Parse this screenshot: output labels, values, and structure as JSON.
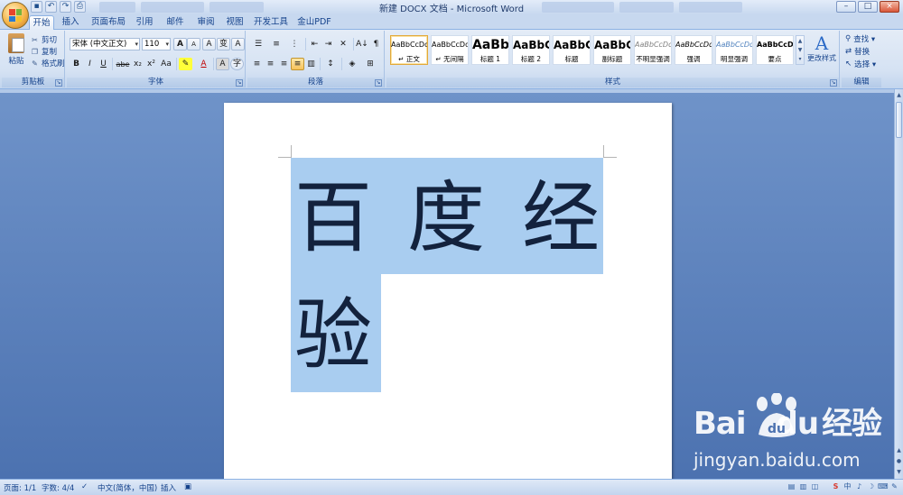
{
  "window": {
    "title": "新建 DOCX 文档 - Microsoft Word",
    "controls": [
      "–",
      "□",
      "×"
    ]
  },
  "quick_access": [
    "save-icon",
    "undo-icon",
    "redo-icon",
    "print-preview-icon"
  ],
  "tabs": [
    {
      "label": "开始",
      "active": true
    },
    {
      "label": "插入"
    },
    {
      "label": "页面布局"
    },
    {
      "label": "引用"
    },
    {
      "label": "邮件"
    },
    {
      "label": "审阅"
    },
    {
      "label": "视图"
    },
    {
      "label": "开发工具"
    },
    {
      "label": "金山PDF"
    }
  ],
  "clipboard": {
    "paste": "粘贴",
    "cut": "剪切",
    "copy": "复制",
    "format_painter": "格式刷",
    "label": "剪贴板"
  },
  "font": {
    "font_name": "宋体 (中文正文)",
    "font_size": "110",
    "label": "字体",
    "buttons": [
      "B",
      "I",
      "U",
      "abe",
      "x₂",
      "x²",
      "Aa",
      "A",
      "A"
    ],
    "grow": "A",
    "shrink": "A",
    "clear": "A",
    "phonetic": "变",
    "border_char": "A",
    "enclose": "字"
  },
  "paragraph": {
    "label": "段落",
    "sort": "A↓",
    "show_marks": "¶"
  },
  "styles": {
    "label": "样式",
    "items": [
      {
        "sample": "AaBbCcDd",
        "name": "↵ 正文",
        "selected": true
      },
      {
        "sample": "AaBbCcDd",
        "name": "↵ 无间隔"
      },
      {
        "sample": "AaBb",
        "name": "标题 1"
      },
      {
        "sample": "AaBbC",
        "name": "标题 2"
      },
      {
        "sample": "AaBbC",
        "name": "标题"
      },
      {
        "sample": "AaBbC",
        "name": "副标题"
      },
      {
        "sample": "AaBbCcDd",
        "name": "不明显强调"
      },
      {
        "sample": "AaBbCcDd",
        "name": "强调"
      },
      {
        "sample": "AaBbCcDd",
        "name": "明显强调"
      },
      {
        "sample": "AaBbCcDd",
        "name": "要点"
      }
    ],
    "change_styles": "更改样式",
    "change_styles_glyph": "A"
  },
  "editing": {
    "label": "编辑",
    "find": "查找 ▾",
    "replace": "替换",
    "select": "选择 ▾"
  },
  "document": {
    "line1": [
      "百",
      "度",
      "经"
    ],
    "line2": [
      "验"
    ],
    "selection_color": "#a9cdf0"
  },
  "status": {
    "page": "页面: 1/1",
    "words": "字数: 4/4",
    "language": "中文(简体，中国)",
    "mode": "插入"
  },
  "tray": [
    "中",
    "♪",
    "☽",
    "⌨",
    "✎"
  ],
  "watermark": {
    "logo_left": "Bai",
    "logo_mid": "du",
    "logo_right": "经验",
    "url": "jingyan.baidu.com"
  },
  "colors": {
    "accent": "#15428b",
    "workspace": "#5a7fb9"
  }
}
